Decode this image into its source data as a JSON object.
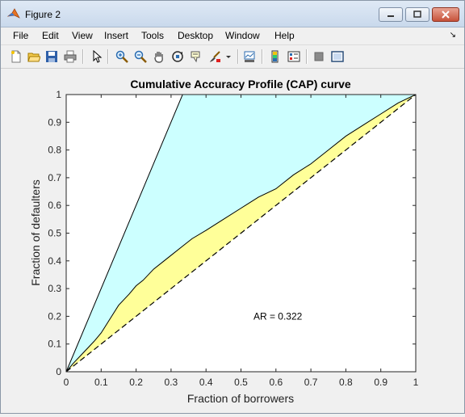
{
  "window": {
    "title": "Figure 2"
  },
  "menu": [
    "File",
    "Edit",
    "View",
    "Insert",
    "Tools",
    "Desktop",
    "Window",
    "Help"
  ],
  "menu_arrow": "↘",
  "toolbar": {
    "icons": [
      "new-figure-icon",
      "open-file-icon",
      "save-icon",
      "print-icon",
      "pointer-icon",
      "zoom-in-icon",
      "zoom-out-icon",
      "pan-hand-icon",
      "rotate-3d-icon",
      "data-cursor-icon",
      "brush-icon",
      "brush-dropdown-icon",
      "link-plot-icon",
      "colorbar-icon",
      "legend-icon",
      "hide-plot-tools-icon",
      "show-plot-tools-icon"
    ]
  },
  "colors": {
    "cyan_fill": "#ccffff",
    "yellow_fill": "#ffff99",
    "line": "#000000"
  },
  "chart_data": {
    "type": "area",
    "title": "Cumulative Accuracy Profile (CAP) curve",
    "xlabel": "Fraction of borrowers",
    "ylabel": "Fraction of defaulters",
    "xlim": [
      0,
      1
    ],
    "ylim": [
      0,
      1
    ],
    "xticks": [
      "0",
      "0.1",
      "0.2",
      "0.3",
      "0.4",
      "0.5",
      "0.6",
      "0.7",
      "0.8",
      "0.9",
      "1"
    ],
    "yticks": [
      "0",
      "0.1",
      "0.2",
      "0.3",
      "0.4",
      "0.5",
      "0.6",
      "0.7",
      "0.8",
      "0.9",
      "1"
    ],
    "annotation": "AR = 0.322",
    "annotation_pos": [
      0.61,
      0.2
    ],
    "perfect_model": {
      "x": [
        0,
        0.333,
        1
      ],
      "y": [
        0,
        1,
        1
      ]
    },
    "random_model": {
      "x": [
        0,
        1
      ],
      "y": [
        0,
        1
      ]
    },
    "cap_curve": {
      "x": [
        0,
        0.02,
        0.05,
        0.08,
        0.1,
        0.12,
        0.15,
        0.18,
        0.2,
        0.22,
        0.25,
        0.28,
        0.3,
        0.33,
        0.36,
        0.4,
        0.45,
        0.5,
        0.55,
        0.6,
        0.65,
        0.7,
        0.75,
        0.8,
        0.85,
        0.9,
        0.95,
        1.0
      ],
      "y": [
        0,
        0.03,
        0.07,
        0.11,
        0.14,
        0.18,
        0.24,
        0.28,
        0.31,
        0.33,
        0.37,
        0.4,
        0.42,
        0.45,
        0.48,
        0.51,
        0.55,
        0.59,
        0.63,
        0.66,
        0.71,
        0.75,
        0.8,
        0.85,
        0.89,
        0.93,
        0.97,
        1.0
      ]
    }
  }
}
